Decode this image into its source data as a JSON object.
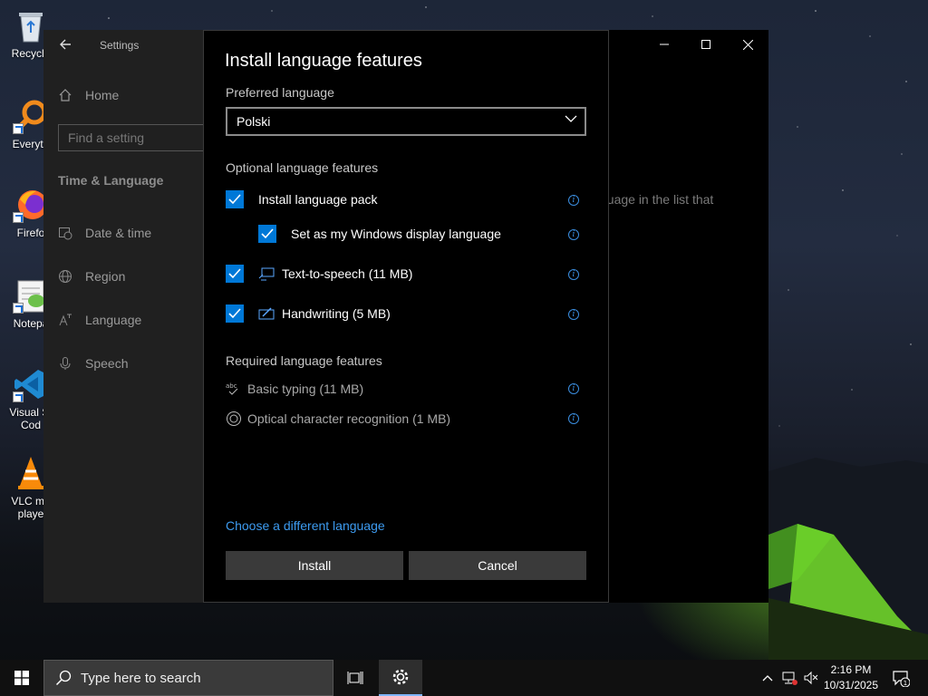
{
  "desktop": {
    "icons": [
      {
        "label": "Recycle",
        "icon": "recycle-bin-icon"
      },
      {
        "label": "Everyth",
        "icon": "everything-search-icon"
      },
      {
        "label": "Firefo",
        "icon": "firefox-icon"
      },
      {
        "label": "Notepa",
        "icon": "notepad-plus-plus-icon"
      },
      {
        "label": "Visual St",
        "label2": "Cod",
        "icon": "vscode-icon"
      },
      {
        "label": "VLC me",
        "label2": "playe",
        "icon": "vlc-icon"
      }
    ]
  },
  "settings": {
    "title": "Settings",
    "search_placeholder": "Find a setting",
    "home_label": "Home",
    "section_heading": "Time & Language",
    "nav": [
      {
        "label": "Date & time",
        "icon": "calendar-clock-icon"
      },
      {
        "label": "Region",
        "icon": "globe-icon"
      },
      {
        "label": "Language",
        "icon": "language-icon"
      },
      {
        "label": "Speech",
        "icon": "microphone-icon"
      }
    ],
    "background_text": "guage in the list that"
  },
  "dialog": {
    "title": "Install language features",
    "preferred_label": "Preferred language",
    "preferred_value": "Polski",
    "optional_heading": "Optional language features",
    "optional": [
      {
        "label": "Install language pack",
        "checked": true
      },
      {
        "label": "Set as my Windows display language",
        "checked": true
      },
      {
        "label": "Text-to-speech (11 MB)",
        "checked": true,
        "icon": "speech-icon"
      },
      {
        "label": "Handwriting (5 MB)",
        "checked": true,
        "icon": "handwriting-icon"
      }
    ],
    "required_heading": "Required language features",
    "required": [
      {
        "label": "Basic typing (11 MB)",
        "icon": "abc-check-icon"
      },
      {
        "label": "Optical character recognition (1 MB)",
        "icon": "ocr-icon"
      }
    ],
    "link": "Choose a different language",
    "install_button": "Install",
    "cancel_button": "Cancel"
  },
  "taskbar": {
    "search_placeholder": "Type here to search",
    "time": "2:16 PM",
    "date": "10/31/2025",
    "notification_count": "1"
  },
  "colors": {
    "accent": "#0078d7",
    "link": "#3d9bf0",
    "dialog_bg": "#000000",
    "taskbar_bg": "#101010"
  }
}
